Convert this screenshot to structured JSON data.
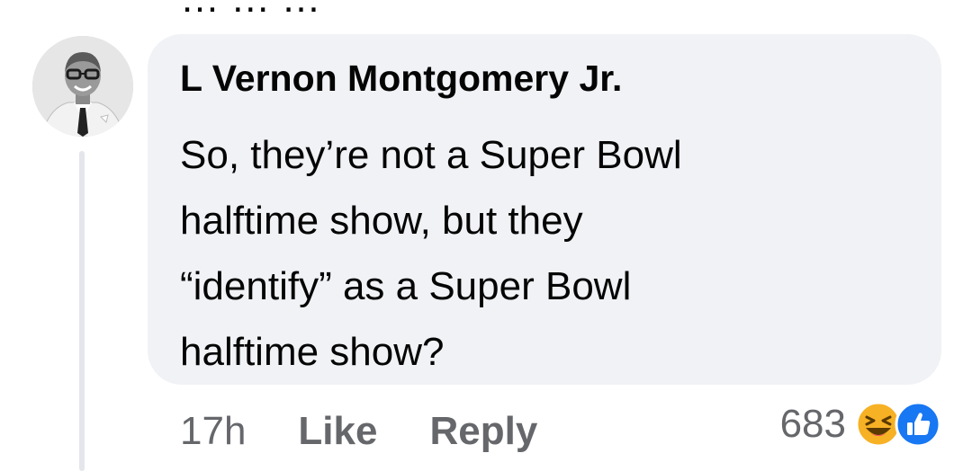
{
  "previous_comment": {
    "partial_text": "… … …"
  },
  "comment": {
    "author": "L Vernon Montgomery Jr.",
    "text_lines": [
      "So, they’re not a Super Bowl",
      "halftime show, but they",
      "“identify” as a Super Bowl",
      "halftime show?"
    ],
    "time": "17h",
    "like_label": "Like",
    "reply_label": "Reply",
    "reaction_count": "683",
    "reactions": [
      "haha-icon",
      "like-icon"
    ]
  },
  "colors": {
    "bubble": "#f0f2f5",
    "text": "#050505",
    "secondary_text": "#65676b",
    "like_blue": "#1877f2",
    "haha_yellow": "#f7b125"
  }
}
